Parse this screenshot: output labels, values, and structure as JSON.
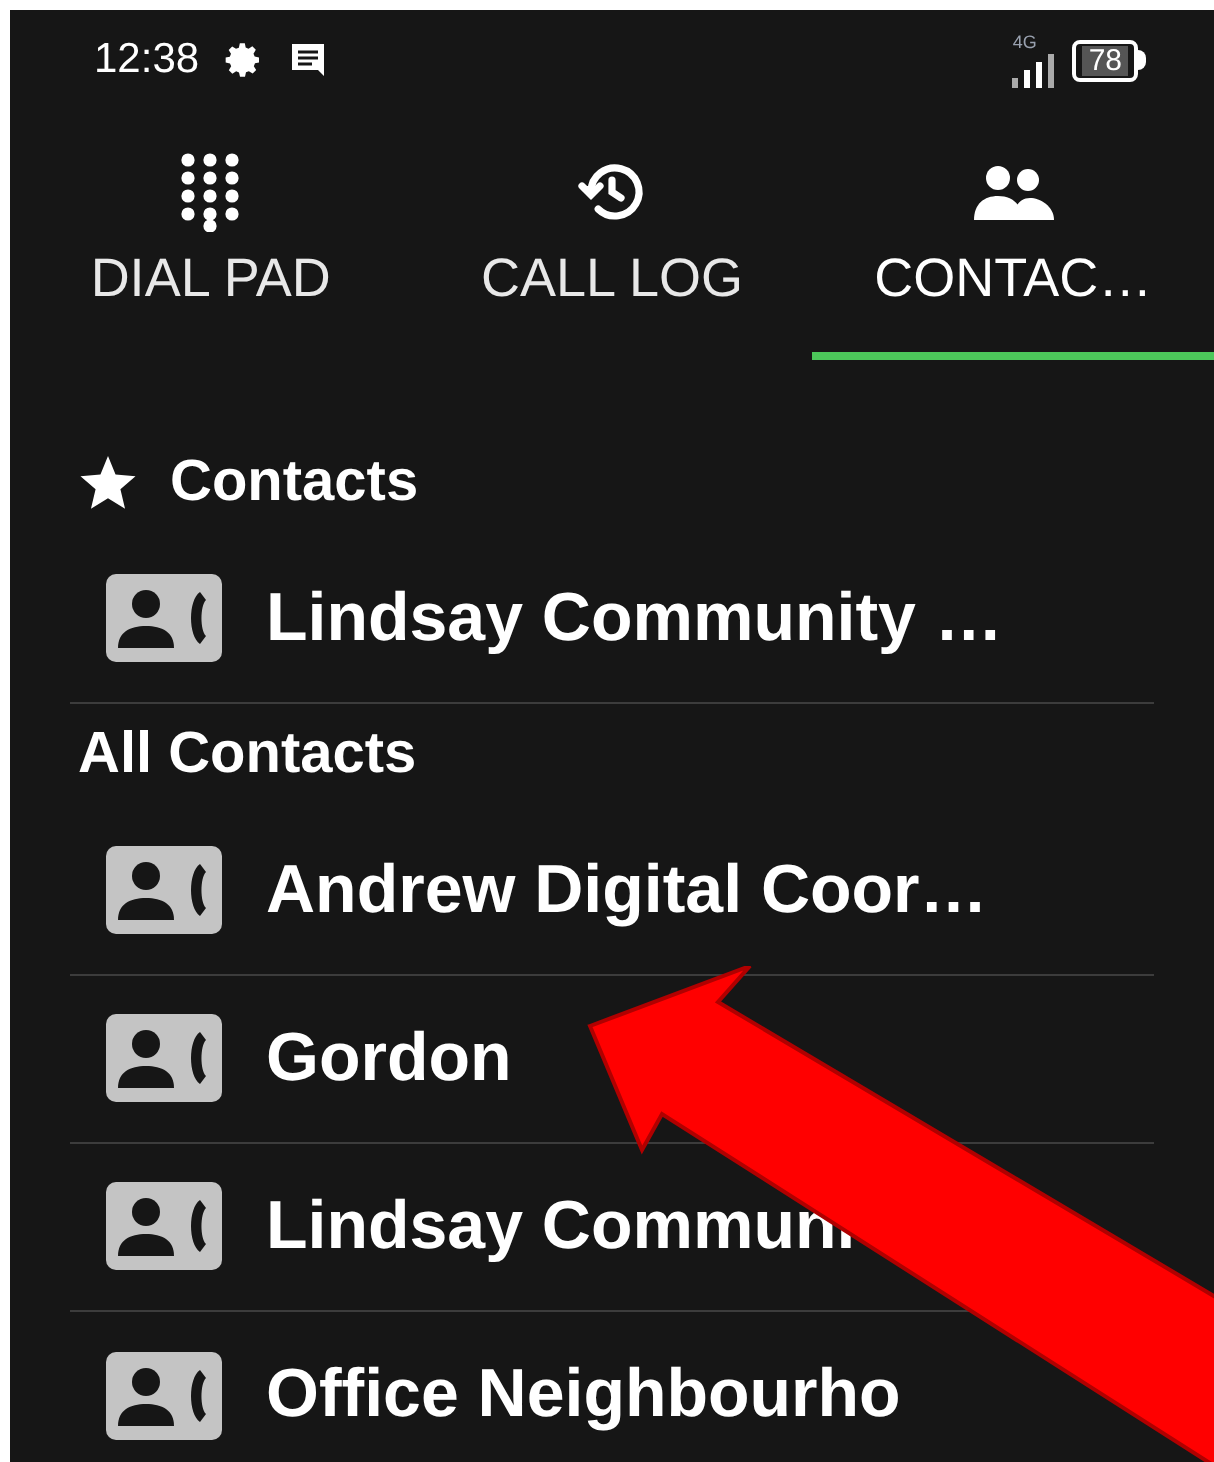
{
  "status_bar": {
    "time": "12:38",
    "network": "4G",
    "battery": "78"
  },
  "tabs": [
    {
      "label": "DIAL PAD",
      "kind": "dialpad",
      "selected": false
    },
    {
      "label": "CALL LOG",
      "kind": "history",
      "selected": false
    },
    {
      "label": "CONTAC…",
      "kind": "people",
      "selected": true
    }
  ],
  "sections": [
    {
      "title": "Contacts",
      "starred": true,
      "contacts": [
        "Lindsay Community …"
      ]
    },
    {
      "title": "All Contacts",
      "starred": false,
      "contacts": [
        "Andrew Digital Coor…",
        "Gordon",
        "Lindsay Communi",
        "Office Neighbourho"
      ]
    }
  ]
}
